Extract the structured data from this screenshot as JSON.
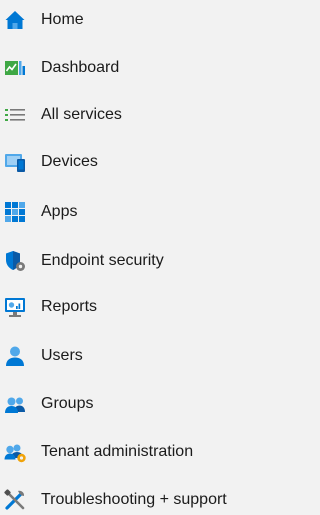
{
  "sidebar": {
    "items": [
      {
        "id": "home",
        "label": "Home",
        "icon": "home-icon"
      },
      {
        "id": "dashboard",
        "label": "Dashboard",
        "icon": "dashboard-icon"
      },
      {
        "id": "all-services",
        "label": "All services",
        "icon": "list-icon"
      },
      {
        "id": "devices",
        "label": "Devices",
        "icon": "devices-icon"
      },
      {
        "id": "apps",
        "label": "Apps",
        "icon": "apps-grid-icon"
      },
      {
        "id": "endpoint-security",
        "label": "Endpoint security",
        "icon": "shield-gear-icon"
      },
      {
        "id": "reports",
        "label": "Reports",
        "icon": "reports-monitor-icon"
      },
      {
        "id": "users",
        "label": "Users",
        "icon": "user-icon"
      },
      {
        "id": "groups",
        "label": "Groups",
        "icon": "group-icon"
      },
      {
        "id": "tenant-administration",
        "label": "Tenant administration",
        "icon": "tenant-admin-icon"
      },
      {
        "id": "troubleshooting-support",
        "label": "Troubleshooting + support",
        "icon": "tools-icon"
      }
    ]
  },
  "colors": {
    "background": "#f2f2f2",
    "text": "#1b1b1b",
    "azure_blue": "#0078d4",
    "light_blue": "#50a8ea",
    "green": "#3fa845"
  }
}
